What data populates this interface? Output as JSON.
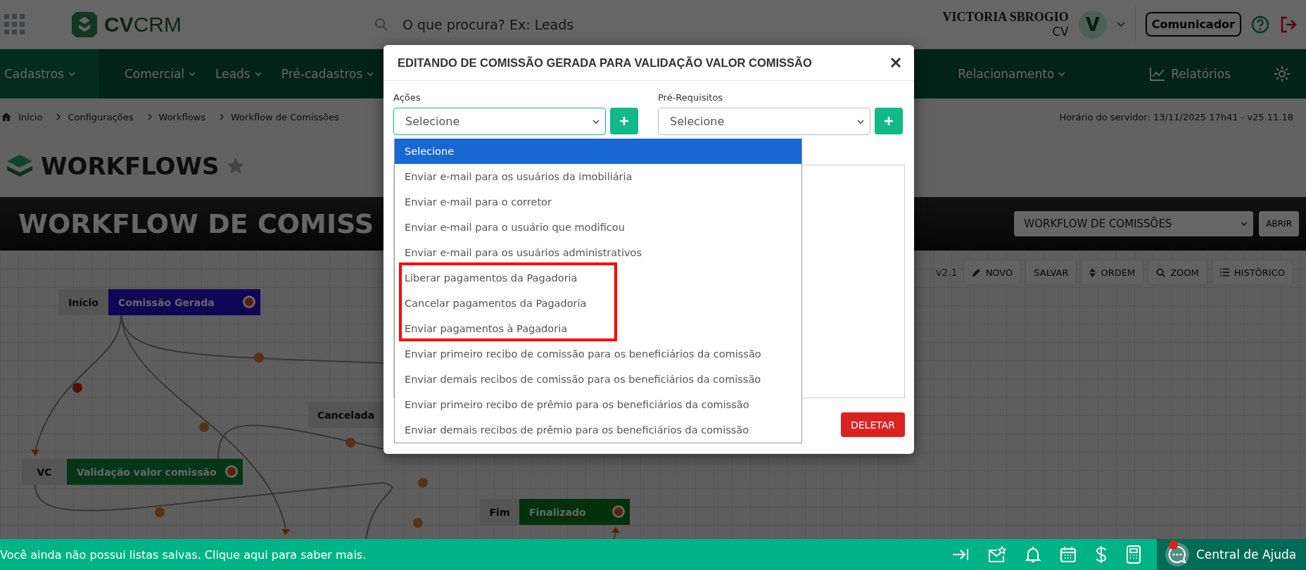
{
  "topbar": {
    "logo": "**CV**CRM",
    "search": {
      "placeholder": "O que procura? Ex: Leads"
    },
    "user": {
      "name": "VICTORIA SBROGIO",
      "role": "CV",
      "avatar": "V"
    },
    "communicator_button": "Comunicador"
  },
  "nav": {
    "items": [
      {
        "label": "Cadastros",
        "selected": true
      },
      {
        "label": "Comercial",
        "selected": false
      },
      {
        "label": "Leads",
        "selected": false
      },
      {
        "label": "Pré-cadastros",
        "selected": false
      },
      {
        "label": "Relacionamento",
        "selected": false
      }
    ],
    "reports": "Relatórios"
  },
  "breadcrumb": [
    "Início",
    "Configurações",
    "Workflows",
    "Workflow de Comissões"
  ],
  "server_time": "Horário do servidor: 13/11/2025 17h41 - v25.11.18",
  "page_title": "WORKFLOWS",
  "favorite": false,
  "workflow_header": {
    "title": "WORKFLOW DE COMISS",
    "select": "WORKFLOW DE COMISSÕES",
    "open_button": "ABRIR"
  },
  "toolbar": {
    "version": "v2.1",
    "buttons": [
      {
        "kind": "pencil",
        "label": "NOVO"
      },
      {
        "kind": "plain",
        "label": "SALVAR"
      },
      {
        "kind": "sort",
        "label": "ORDEM"
      },
      {
        "kind": "search",
        "label": "ZOOM"
      },
      {
        "kind": "list",
        "label": "HISTÓRICO"
      }
    ]
  },
  "canvas": {
    "nodes": [
      {
        "kind": "start",
        "tag": "Início",
        "name": "Comissão Gerada"
      },
      {
        "kind": "cancel",
        "tag": "Cancelada"
      },
      {
        "kind": "step",
        "tag": "VC",
        "name": "Validação valor comissão"
      },
      {
        "kind": "end",
        "tag": "Fim",
        "name": "Finalizado"
      }
    ]
  },
  "modal": {
    "title": "EDITANDO DE COMISSÃO GERADA PARA VALIDAÇÃO VALOR COMISSÃO",
    "actions": {
      "label": "Ações",
      "value": "Selecione",
      "expanded": true
    },
    "prerequisites": {
      "label": "Pré-Requisitos",
      "value": "Selecione"
    },
    "actions_dropdown": {
      "options": [
        {
          "label": "Selecione",
          "selected": true,
          "highlighted": false
        },
        {
          "label": "Enviar e-mail para os usuários da imobiliária",
          "selected": false,
          "highlighted": false
        },
        {
          "label": "Enviar e-mail para o corretor",
          "selected": false,
          "highlighted": false
        },
        {
          "label": "Enviar e-mail para o usuário que modificou",
          "selected": false,
          "highlighted": false
        },
        {
          "label": "Enviar e-mail para os usuários administrativos",
          "selected": false,
          "highlighted": false
        },
        {
          "label": "Liberar pagamentos da Pagadoria",
          "selected": false,
          "highlighted": true
        },
        {
          "label": "Cancelar pagamentos da Pagadoria",
          "selected": false,
          "highlighted": true
        },
        {
          "label": "Enviar pagamentos à Pagadoria",
          "selected": false,
          "highlighted": true
        },
        {
          "label": "Enviar primeiro recibo de comissão para os beneficiários da comissão",
          "selected": false,
          "highlighted": false
        },
        {
          "label": "Enviar demais recibos de comissão para os beneficiários da comissão",
          "selected": false,
          "highlighted": false
        },
        {
          "label": "Enviar primeiro recibo de prêmio para os beneficiários da comissão",
          "selected": false,
          "highlighted": false
        },
        {
          "label": "Enviar demais recibos de prêmio para os beneficiários da comissão",
          "selected": false,
          "highlighted": false
        }
      ]
    },
    "delete_button": "DELETAR"
  },
  "footer": {
    "message": "Você ainda não possui listas salvas. Clique aqui para saber mais.",
    "help": "Central de Ajuda",
    "help_notification": true
  }
}
